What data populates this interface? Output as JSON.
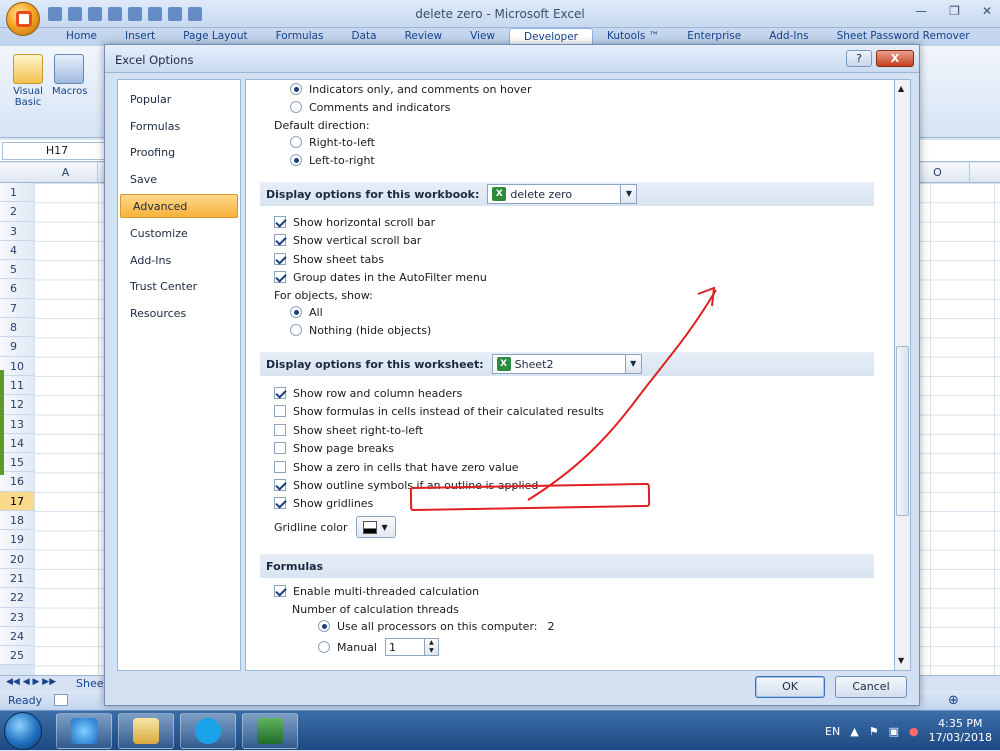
{
  "excel": {
    "window_title": "delete zero - Microsoft Excel",
    "ribbon_tabs": [
      "Home",
      "Insert",
      "Page Layout",
      "Formulas",
      "Data",
      "Review",
      "View",
      "Developer",
      "Kutools ™",
      "Enterprise",
      "Add-Ins",
      "Sheet Password Remover"
    ],
    "active_tab": "Developer",
    "ribbon_buttons": [
      "Visual Basic",
      "Macros"
    ],
    "name_box": "H17",
    "columns": [
      "A",
      "O"
    ],
    "rows": [
      "1",
      "2",
      "3",
      "4",
      "5",
      "6",
      "7",
      "8",
      "9",
      "10",
      "11",
      "12",
      "13",
      "14",
      "15",
      "16",
      "17",
      "18",
      "19",
      "20",
      "21",
      "22",
      "23",
      "24",
      "25"
    ],
    "selected_row": "17",
    "sheet_tab": "Shee",
    "status": "Ready"
  },
  "dialog": {
    "title": "Excel Options",
    "help_label": "?",
    "close_label": "X",
    "nav": [
      "Popular",
      "Formulas",
      "Proofing",
      "Save",
      "Advanced",
      "Customize",
      "Add-Ins",
      "Trust Center",
      "Resources"
    ],
    "active_nav": "Advanced",
    "ok_label": "OK",
    "cancel_label": "Cancel",
    "content": {
      "indicators_only": "Indicators only, and comments on hover",
      "comments_and_indicators": "Comments and indicators",
      "default_direction": "Default direction:",
      "right_to_left": "Right-to-left",
      "left_to_right": "Left-to-right",
      "workbook_section": "Display options for this workbook:",
      "workbook_value": "delete zero",
      "show_hscroll": "Show horizontal scroll bar",
      "show_vscroll": "Show vertical scroll bar",
      "show_sheet_tabs": "Show sheet tabs",
      "group_dates": "Group dates in the AutoFilter menu",
      "for_objects": "For objects, show:",
      "all": "All",
      "nothing": "Nothing (hide objects)",
      "worksheet_section": "Display options for this worksheet:",
      "worksheet_value": "Sheet2",
      "show_headers": "Show row and column headers",
      "show_formulas": "Show formulas in cells instead of their calculated results",
      "sheet_rtl": "Show sheet right-to-left",
      "page_breaks": "Show page breaks",
      "show_zero": "Show a zero in cells that have zero value",
      "outline_symbols": "Show outline symbols if an outline is applied",
      "gridlines": "Show gridlines",
      "gridline_color": "Gridline color",
      "formulas_section": "Formulas",
      "multi_thread": "Enable multi-threaded calculation",
      "num_threads": "Number of calculation threads",
      "use_all": "Use all processors on this computer:",
      "use_all_value": "2",
      "manual": "Manual",
      "manual_value": "1"
    }
  },
  "taskbar": {
    "lang": "EN",
    "time": "4:35 PM",
    "date": "17/03/2018"
  },
  "colors": {
    "highlight": "#e02020",
    "accent": "#f7b23c"
  }
}
